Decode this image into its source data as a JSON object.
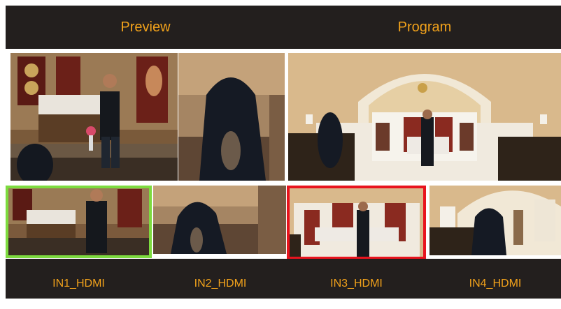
{
  "header": {
    "preview_label": "Preview",
    "program_label": "Program"
  },
  "inputs": [
    {
      "label": "IN1_HDMI",
      "state": "preview"
    },
    {
      "label": "IN2_HDMI",
      "state": "idle"
    },
    {
      "label": "IN3_HDMI",
      "state": "program"
    },
    {
      "label": "IN4_HDMI",
      "state": "idle"
    }
  ],
  "colors": {
    "accent": "#f2a21b",
    "bar_background": "#231f1e",
    "preview_selection": "#7ddb3f",
    "program_selection": "#e8141e"
  }
}
